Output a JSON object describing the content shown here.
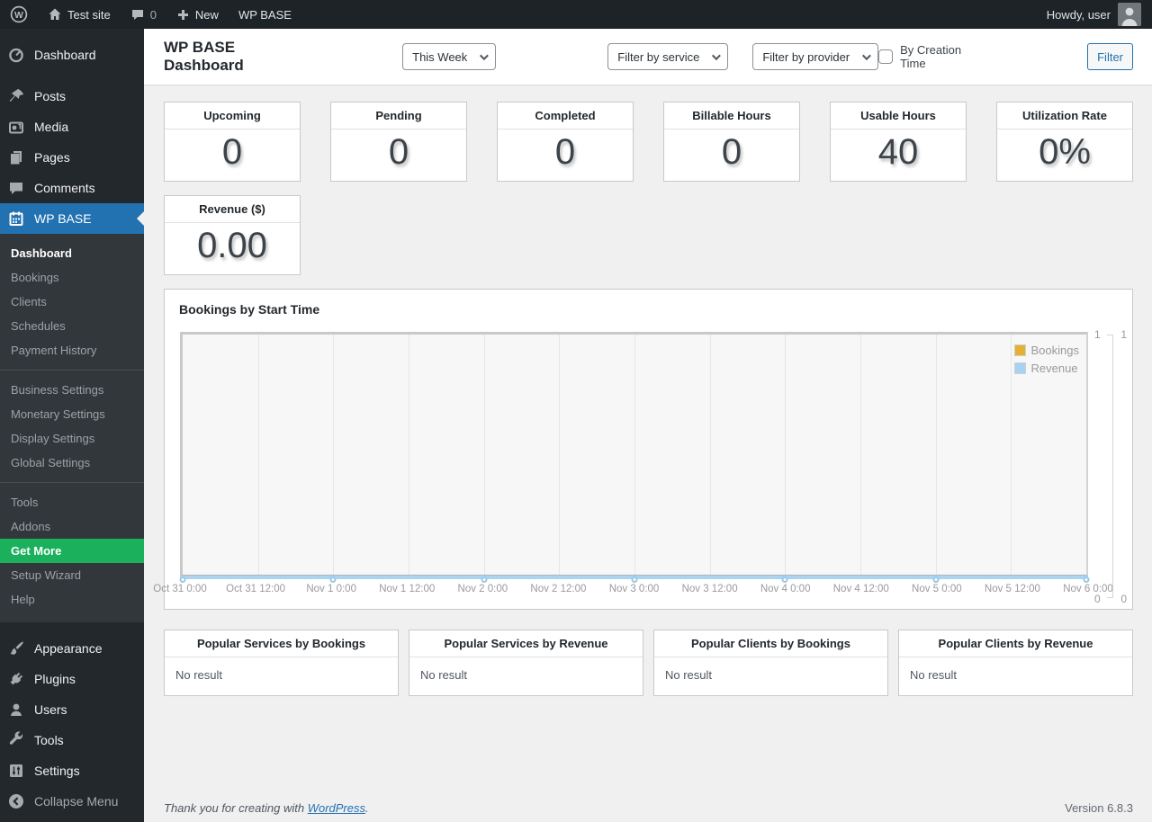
{
  "admin_bar": {
    "site_name": "Test site",
    "comments_count": "0",
    "new_label": "New",
    "wp_base_label": "WP BASE",
    "howdy": "Howdy, user"
  },
  "sidebar": {
    "top_items": [
      {
        "label": "Dashboard"
      },
      {
        "label": "Posts"
      },
      {
        "label": "Media"
      },
      {
        "label": "Pages"
      },
      {
        "label": "Comments"
      },
      {
        "label": "WP BASE"
      }
    ],
    "wpbase_submenu": {
      "group1": [
        "Dashboard",
        "Bookings",
        "Clients",
        "Schedules",
        "Payment History"
      ],
      "group2": [
        "Business Settings",
        "Monetary Settings",
        "Display Settings",
        "Global Settings"
      ],
      "group3": [
        "Tools",
        "Addons",
        "Get More",
        "Setup Wizard",
        "Help"
      ]
    },
    "active_item": "WP BASE",
    "active_submenu_item": "Dashboard",
    "highlight_item": "Get More",
    "bottom_items": [
      {
        "label": "Appearance"
      },
      {
        "label": "Plugins"
      },
      {
        "label": "Users"
      },
      {
        "label": "Tools"
      },
      {
        "label": "Settings"
      },
      {
        "label": "Collapse Menu"
      }
    ],
    "colors": {
      "active_blue": "#2271b1",
      "get_more_green": "#1bb05c"
    }
  },
  "header": {
    "title": "WP BASE Dashboard",
    "period_select": "This Week",
    "service_select": "Filter by service",
    "provider_select": "Filter by provider",
    "creation_time_label": "By Creation Time",
    "filter_button": "Filter"
  },
  "stats": {
    "cards": [
      {
        "label": "Upcoming",
        "value": "0"
      },
      {
        "label": "Pending",
        "value": "0"
      },
      {
        "label": "Completed",
        "value": "0"
      },
      {
        "label": "Billable Hours",
        "value": "0"
      },
      {
        "label": "Usable Hours",
        "value": "40"
      },
      {
        "label": "Utilization Rate",
        "value": "0%"
      },
      {
        "label": "Revenue ($)",
        "value": "0.00"
      }
    ]
  },
  "chart_data": {
    "type": "line",
    "title": "Bookings by Start Time",
    "x_tick_labels": [
      "Oct 31 0:00",
      "Oct 31 12:00",
      "Nov 1 0:00",
      "Nov 1 12:00",
      "Nov 2 0:00",
      "Nov 2 12:00",
      "Nov 3 0:00",
      "Nov 3 12:00",
      "Nov 4 0:00",
      "Nov 4 12:00",
      "Nov 5 0:00",
      "Nov 5 12:00",
      "Nov 6 0:00"
    ],
    "series": [
      {
        "name": "Bookings",
        "color": "#e4b230",
        "x": [
          "Oct 31 0:00",
          "Nov 1 0:00",
          "Nov 2 0:00",
          "Nov 3 0:00",
          "Nov 4 0:00",
          "Nov 5 0:00",
          "Nov 6 0:00"
        ],
        "values": [
          0,
          0,
          0,
          0,
          0,
          0,
          0
        ],
        "ylim": [
          0,
          1
        ]
      },
      {
        "name": "Revenue",
        "color": "#a8d2f2",
        "x": [
          "Oct 31 0:00",
          "Nov 1 0:00",
          "Nov 2 0:00",
          "Nov 3 0:00",
          "Nov 4 0:00",
          "Nov 5 0:00",
          "Nov 6 0:00"
        ],
        "values": [
          0,
          0,
          0,
          0,
          0,
          0,
          0
        ],
        "ylim": [
          0,
          1
        ]
      }
    ],
    "legend": [
      {
        "label": "Bookings",
        "color": "#e4b230"
      },
      {
        "label": "Revenue",
        "color": "#a8d2f2"
      }
    ],
    "legend_position": "top-right",
    "grid": "vertical-only",
    "right_axis": {
      "axis1_top": "1",
      "axis1_bottom": "0",
      "axis2_top": "1",
      "axis2_bottom": "0"
    }
  },
  "popular": [
    {
      "title": "Popular Services by Bookings",
      "body": "No result"
    },
    {
      "title": "Popular Services by Revenue",
      "body": "No result"
    },
    {
      "title": "Popular Clients by Bookings",
      "body": "No result"
    },
    {
      "title": "Popular Clients by Revenue",
      "body": "No result"
    }
  ],
  "footer": {
    "thanks_prefix": "Thank you for creating with ",
    "link": "WordPress",
    "suffix": ".",
    "version": "Version 6.8.3"
  }
}
